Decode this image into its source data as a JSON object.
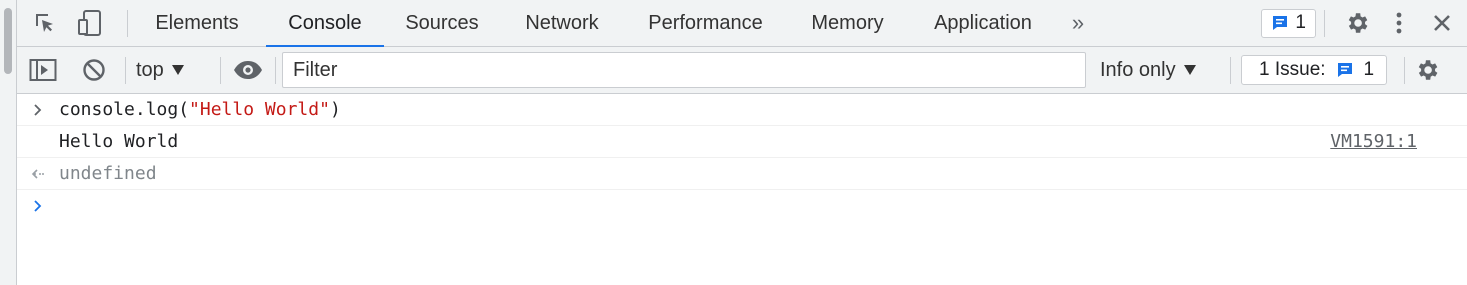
{
  "tabs": [
    {
      "label": "Elements",
      "active": false
    },
    {
      "label": "Console",
      "active": true
    },
    {
      "label": "Sources",
      "active": false
    },
    {
      "label": "Network",
      "active": false
    },
    {
      "label": "Performance",
      "active": false
    },
    {
      "label": "Memory",
      "active": false
    },
    {
      "label": "Application",
      "active": false
    }
  ],
  "more_tabs_glyph": "»",
  "messages_badge": {
    "count": "1",
    "icon": "message-icon",
    "color": "#1a73e8"
  },
  "toolbar": {
    "context": "top",
    "filter_placeholder": "Filter",
    "log_level": "Info only",
    "issues_label": "1 Issue:",
    "issues_count": "1"
  },
  "console": {
    "input": {
      "prefix": "console.log(",
      "string": "\"Hello World\"",
      "suffix": ")"
    },
    "output": {
      "text": "Hello World",
      "source": "VM1591:1"
    },
    "result": "undefined"
  },
  "colors": {
    "accent": "#1a73e8",
    "string": "#c41a16",
    "toolbar_bg": "#f1f3f4"
  }
}
